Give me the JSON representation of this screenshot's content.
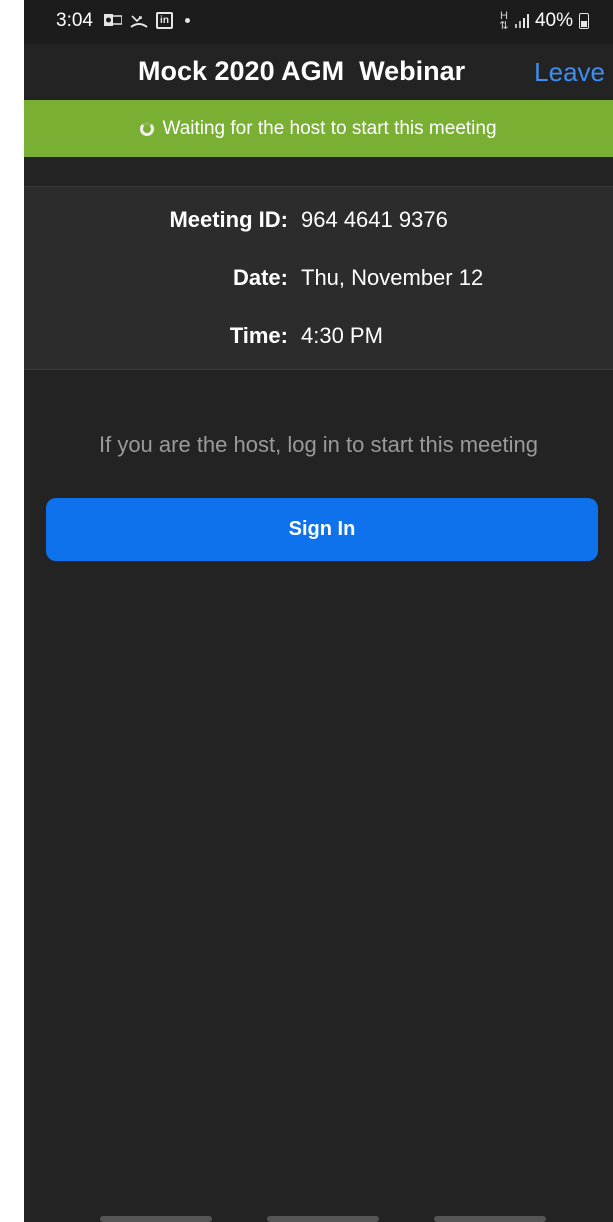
{
  "status_bar": {
    "time": "3:04",
    "icons_left": [
      "outlook-icon",
      "missed-call-icon",
      "linkedin-icon",
      "notification-dot"
    ],
    "linkedin_glyph": "in",
    "battery": "40%",
    "icons_right": [
      "network-activity-icon",
      "signal-icon",
      "battery-icon"
    ]
  },
  "header": {
    "title": "Mock 2020 AGM  Webinar",
    "leave_label": "Leave"
  },
  "banner": {
    "text": "Waiting for the host to start this meeting",
    "color": "#79b034"
  },
  "meeting_info": {
    "rows": [
      {
        "label": "Meeting ID:",
        "value": "964 4641 9376"
      },
      {
        "label": "Date:",
        "value": "Thu, November 12"
      },
      {
        "label": "Time:",
        "value": "4:30 PM"
      }
    ]
  },
  "host_hint": "If you are the host, log in to start this meeting",
  "sign_in": {
    "label": "Sign In",
    "color": "#0e72ed"
  },
  "colors": {
    "background": "#232323",
    "accent": "#3d8ef0"
  }
}
